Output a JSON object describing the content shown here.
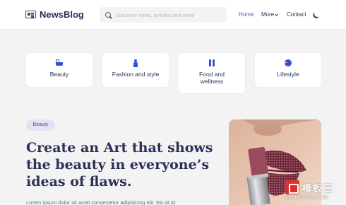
{
  "header": {
    "logo_text": "NewsBlog",
    "search_placeholder": "Discover news, articles and more",
    "nav": {
      "home": "Home",
      "more": "More",
      "contact": "Contact"
    }
  },
  "categories": [
    {
      "label": "Beauty",
      "icon": "bathtub-icon"
    },
    {
      "label": "Fashion and style",
      "icon": "person-icon"
    },
    {
      "label": "Food and wellness",
      "icon": "utensils-icon"
    },
    {
      "label": "Lifestyle",
      "icon": "pie-chart-icon"
    }
  ],
  "hero": {
    "badge": "Beauty",
    "title": "Create an Art that shows the beauty in everyone’s ideas of flaws.",
    "text": "Lorem ipsum dolor sit amet consectetur adipisicing elit. Ea sit id"
  },
  "watermark": {
    "title": "模板王",
    "url": "MOBANWANG.COM"
  },
  "colors": {
    "accent": "#4a5ad8",
    "icon_blue": "#3a4fd0",
    "badge_bg": "#e4e3f4",
    "page_bg": "#f3f3f4"
  }
}
